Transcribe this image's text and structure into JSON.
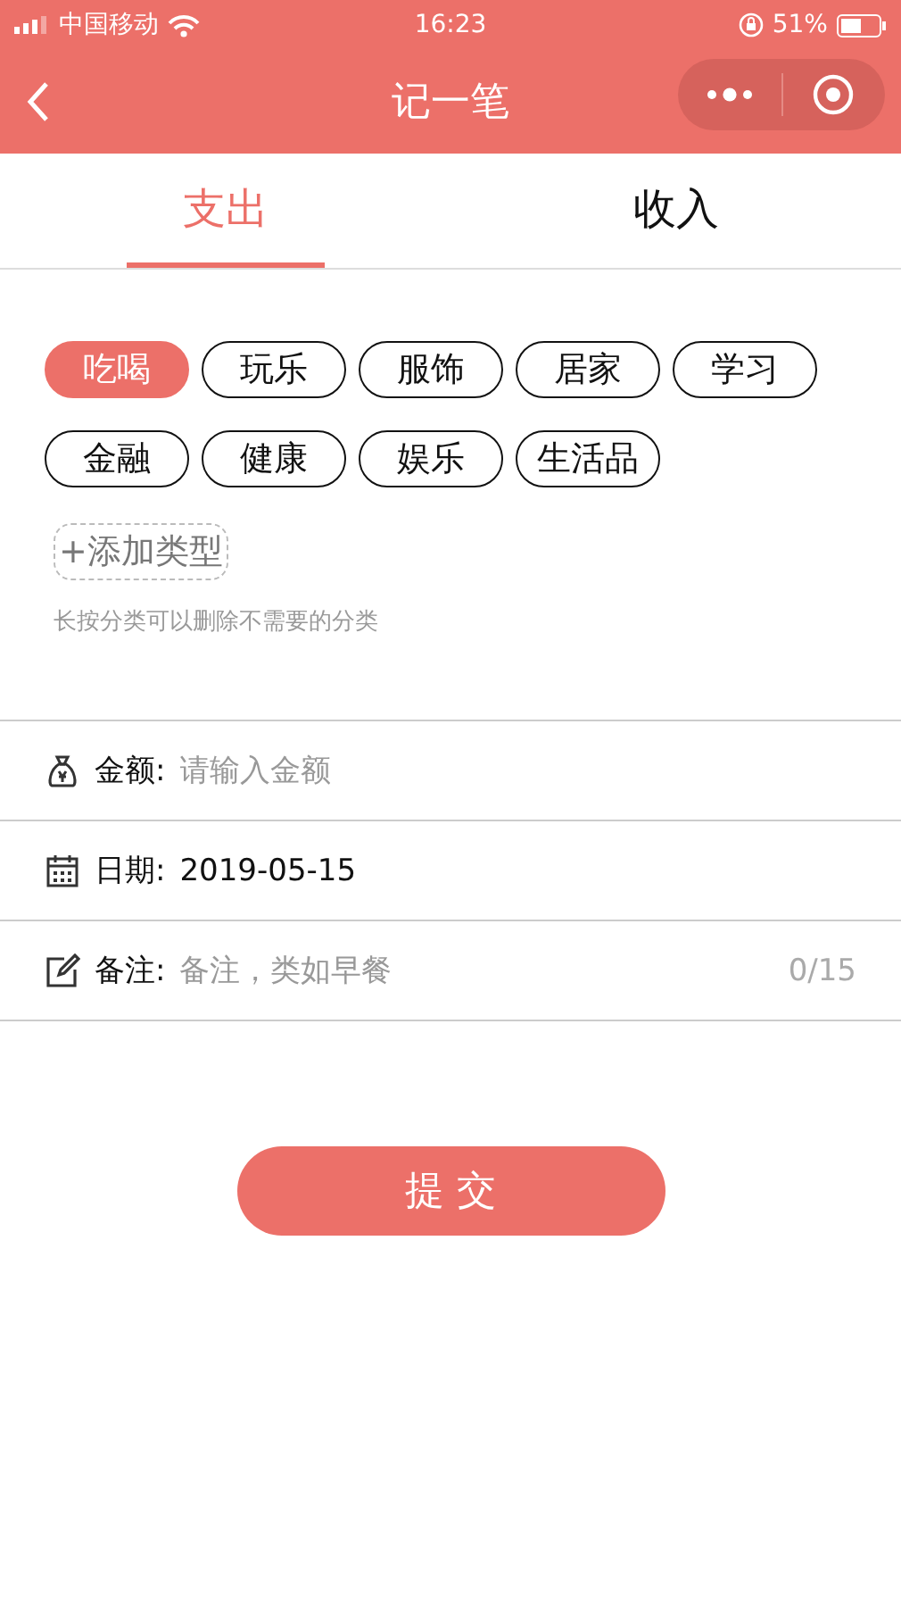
{
  "status_bar": {
    "carrier": "中国移动",
    "time": "16:23",
    "battery": "51%"
  },
  "nav": {
    "title": "记一笔"
  },
  "tabs": [
    {
      "label": "支出",
      "selected": true
    },
    {
      "label": "收入",
      "selected": false
    }
  ],
  "categories": [
    {
      "label": "吃喝",
      "selected": true
    },
    {
      "label": "玩乐",
      "selected": false
    },
    {
      "label": "服饰",
      "selected": false
    },
    {
      "label": "居家",
      "selected": false
    },
    {
      "label": "学习",
      "selected": false
    },
    {
      "label": "金融",
      "selected": false
    },
    {
      "label": "健康",
      "selected": false
    },
    {
      "label": "娱乐",
      "selected": false
    },
    {
      "label": "生活品",
      "selected": false
    }
  ],
  "add_category": "+添加类型",
  "hint": "长按分类可以删除不需要的分类",
  "fields": [
    {
      "kind": "amount",
      "label": "金额:",
      "placeholder": "请输入金额"
    },
    {
      "kind": "date",
      "label": "日期:",
      "value": "2019-05-15"
    },
    {
      "kind": "note",
      "label": "备注:",
      "placeholder": "备注，类如早餐",
      "counter": "0/15"
    }
  ],
  "submit": "提 交"
}
